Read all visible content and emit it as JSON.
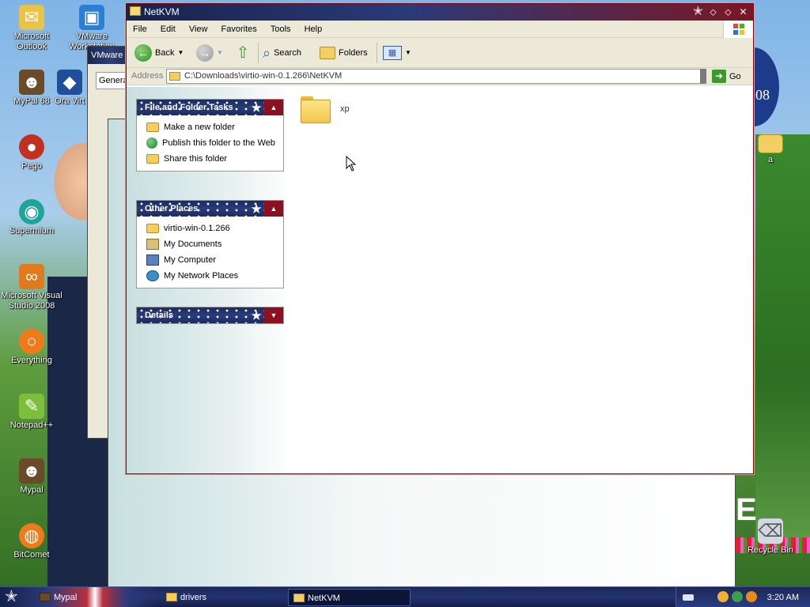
{
  "desktop": {
    "icons": [
      {
        "label": "Microsoft Outlook",
        "icon": "outlook-icon",
        "color": "#e9c24a",
        "glyph": "✉"
      },
      {
        "label": "VMware Workstation",
        "icon": "vmware-icon",
        "color": "#2a7fd4",
        "glyph": "▣"
      },
      {
        "label": "MyPal 68",
        "icon": "mypal-icon",
        "color": "#6b4a2a",
        "glyph": "☻"
      },
      {
        "label": "Ora Virt",
        "icon": "virtualbox-icon",
        "color": "#1f4e9a",
        "glyph": "◆"
      },
      {
        "label": "Pego",
        "icon": "pego-icon",
        "color": "#c2301f",
        "glyph": "●"
      },
      {
        "label": "Supermium",
        "icon": "supermium-icon",
        "color": "#1fa49a",
        "glyph": "◉"
      },
      {
        "label": "Microsoft Visual Studio 2008",
        "icon": "visual-studio-icon",
        "color": "#e07a1f",
        "glyph": "∞"
      },
      {
        "label": "Everything",
        "icon": "everything-icon",
        "color": "#f07a1a",
        "glyph": "○"
      },
      {
        "label": "Notepad++",
        "icon": "notepadpp-icon",
        "color": "#7dbf3a",
        "glyph": "✎"
      },
      {
        "label": "Mypal",
        "icon": "mypal-icon",
        "color": "#6b4a2a",
        "glyph": "☻"
      },
      {
        "label": "BitComet",
        "icon": "bitcomet-icon",
        "color": "#f07a1a",
        "glyph": "◍"
      },
      {
        "label": "a",
        "icon": "folder-icon",
        "color": "#f3cf62",
        "glyph": ""
      },
      {
        "label": "Recycle Bin",
        "icon": "recycle-bin-icon",
        "color": "#cfd8e3",
        "glyph": "🗑"
      }
    ],
    "bg_window_title": "VMware W",
    "bg_tab": "Genera",
    "bg_text": "08"
  },
  "window": {
    "title": "NetKVM",
    "menu": [
      "File",
      "Edit",
      "View",
      "Favorites",
      "Tools",
      "Help"
    ],
    "toolbar": {
      "back": "Back",
      "search": "Search",
      "folders": "Folders"
    },
    "address": {
      "label": "Address",
      "value": "C:\\Downloads\\virtio-win-0.1.266\\NetKVM",
      "go": "Go"
    },
    "panels": {
      "tasks": {
        "title": "File and Folder Tasks",
        "items": [
          "Make a new folder",
          "Publish this folder to the Web",
          "Share this folder"
        ]
      },
      "places": {
        "title": "Other Places",
        "items": [
          "virtio-win-0.1.266",
          "My Documents",
          "My Computer",
          "My Network Places"
        ]
      },
      "details": {
        "title": "Details"
      }
    },
    "files": [
      {
        "name": "xp",
        "type": "folder"
      }
    ]
  },
  "taskbar": {
    "tasks": [
      {
        "label": "Mypal",
        "active": false
      },
      {
        "label": "drivers",
        "active": false
      },
      {
        "label": "NetKVM",
        "active": true
      }
    ],
    "clock": "3:20 AM"
  },
  "colors": {
    "accent_navy": "#1d2b5e",
    "accent_red": "#8b1020",
    "folder_yellow": "#f3cf62"
  }
}
